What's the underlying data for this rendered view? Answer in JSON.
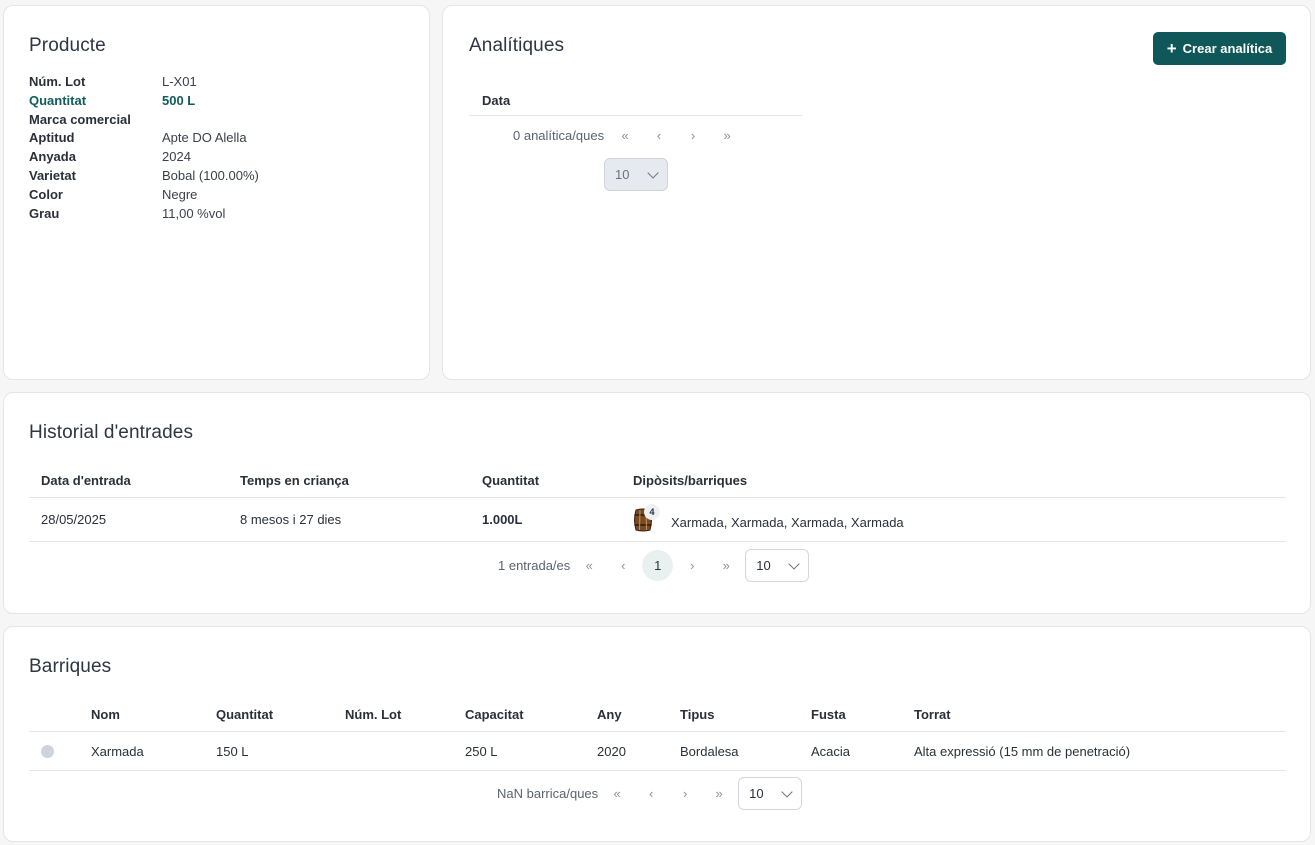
{
  "product": {
    "title": "Producte",
    "rows": [
      {
        "key": "Núm. Lot",
        "value": "L-X01"
      },
      {
        "key": "Quantitat",
        "value": "500 L"
      },
      {
        "key": "Marca comercial",
        "value": ""
      },
      {
        "key": "Aptitud",
        "value": "Apte DO Alella"
      },
      {
        "key": "Anyada",
        "value": "2024"
      },
      {
        "key": "Varietat",
        "value": "Bobal (100.00%)"
      },
      {
        "key": "Color",
        "value": "Negre"
      },
      {
        "key": "Grau",
        "value": "11,00 %vol"
      }
    ]
  },
  "analytics": {
    "title": "Analítiques",
    "create_button": "Crear analítica",
    "columns": [
      "Data"
    ],
    "pager": {
      "count_label": "0 analítica/ques",
      "page_size": "10"
    }
  },
  "history": {
    "title": "Historial d'entrades",
    "columns": [
      "Data d'entrada",
      "Temps en criança",
      "Quantitat",
      "Dipòsits/barriques"
    ],
    "rows": [
      {
        "date": "28/05/2025",
        "aging": "8 mesos i 27 dies",
        "quantity": "1.000L",
        "badge": "4",
        "containers": "Xarmada, Xarmada, Xarmada, Xarmada"
      }
    ],
    "pager": {
      "count_label": "1 entrada/es",
      "current_page": "1",
      "page_size": "10"
    }
  },
  "barrels": {
    "title": "Barriques",
    "columns": [
      "Nom",
      "Quantitat",
      "Núm. Lot",
      "Capacitat",
      "Any",
      "Tipus",
      "Fusta",
      "Torrat"
    ],
    "rows": [
      {
        "name": "Xarmada",
        "quantity": "150 L",
        "lot": "",
        "capacity": "250 L",
        "year": "2020",
        "type": "Bordalesa",
        "wood": "Acacia",
        "toast": "Alta expressió (15 mm de penetració)"
      }
    ],
    "pager": {
      "count_label": "NaN barrica/ques",
      "page_size": "10"
    }
  },
  "icons": {
    "first": "«",
    "prev": "‹",
    "next": "›",
    "last": "»"
  },
  "colors": {
    "accent": "#0f5759",
    "highlight_text": "#0f5c5a"
  }
}
